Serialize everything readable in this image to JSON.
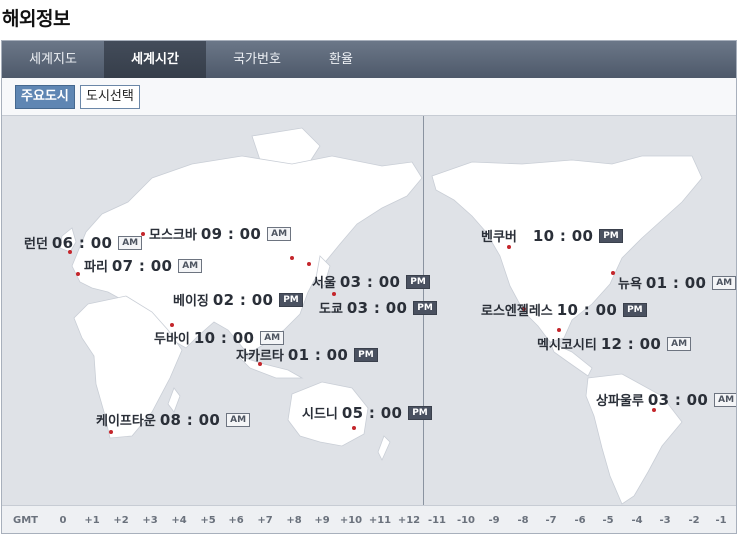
{
  "page": {
    "title": "해외정보"
  },
  "tabs": [
    {
      "label": "세계지도",
      "active": false
    },
    {
      "label": "세계시간",
      "active": true
    },
    {
      "label": "국가번호",
      "active": false
    },
    {
      "label": "환율",
      "active": false
    }
  ],
  "subtabs": {
    "major": "주요도시",
    "select": "도시선택"
  },
  "cities": [
    {
      "name": "런던",
      "time": "06 : 00",
      "ampm": "AM"
    },
    {
      "name": "파리",
      "time": "07 : 00",
      "ampm": "AM"
    },
    {
      "name": "모스크바",
      "time": "09 : 00",
      "ampm": "AM"
    },
    {
      "name": "베이징",
      "time": "02 : 00",
      "ampm": "PM"
    },
    {
      "name": "서울",
      "time": "03 : 00",
      "ampm": "PM"
    },
    {
      "name": "도쿄",
      "time": "03 : 00",
      "ampm": "PM"
    },
    {
      "name": "두바이",
      "time": "10 : 00",
      "ampm": "AM"
    },
    {
      "name": "자카르타",
      "time": "01 : 00",
      "ampm": "PM"
    },
    {
      "name": "케이프타운",
      "time": "08 : 00",
      "ampm": "AM"
    },
    {
      "name": "시드니",
      "time": "05 : 00",
      "ampm": "PM"
    },
    {
      "name": "벤쿠버",
      "time": "10 : 00",
      "ampm": "PM"
    },
    {
      "name": "로스엔젤레스",
      "time": "10 : 00",
      "ampm": "PM"
    },
    {
      "name": "뉴욕",
      "time": "01 : 00",
      "ampm": "AM"
    },
    {
      "name": "멕시코시티",
      "time": "12 : 00",
      "ampm": "AM"
    },
    {
      "name": "상파울루",
      "time": "03 : 00",
      "ampm": "AM"
    }
  ],
  "gmt": {
    "label": "GMT",
    "offsets": [
      "0",
      "+1",
      "+2",
      "+3",
      "+4",
      "+5",
      "+6",
      "+7",
      "+8",
      "+9",
      "+10",
      "+11",
      "+12",
      "-11",
      "-10",
      "-9",
      "-8",
      "-7",
      "-6",
      "-5",
      "-4",
      "-3",
      "-2",
      "-1"
    ]
  },
  "colors": {
    "tabbar": "#5a6577",
    "active_tab": "#3b4350",
    "selected_button": "#5f86b3",
    "city_dot": "#c4262c",
    "pm_badge": "#4a5160"
  }
}
